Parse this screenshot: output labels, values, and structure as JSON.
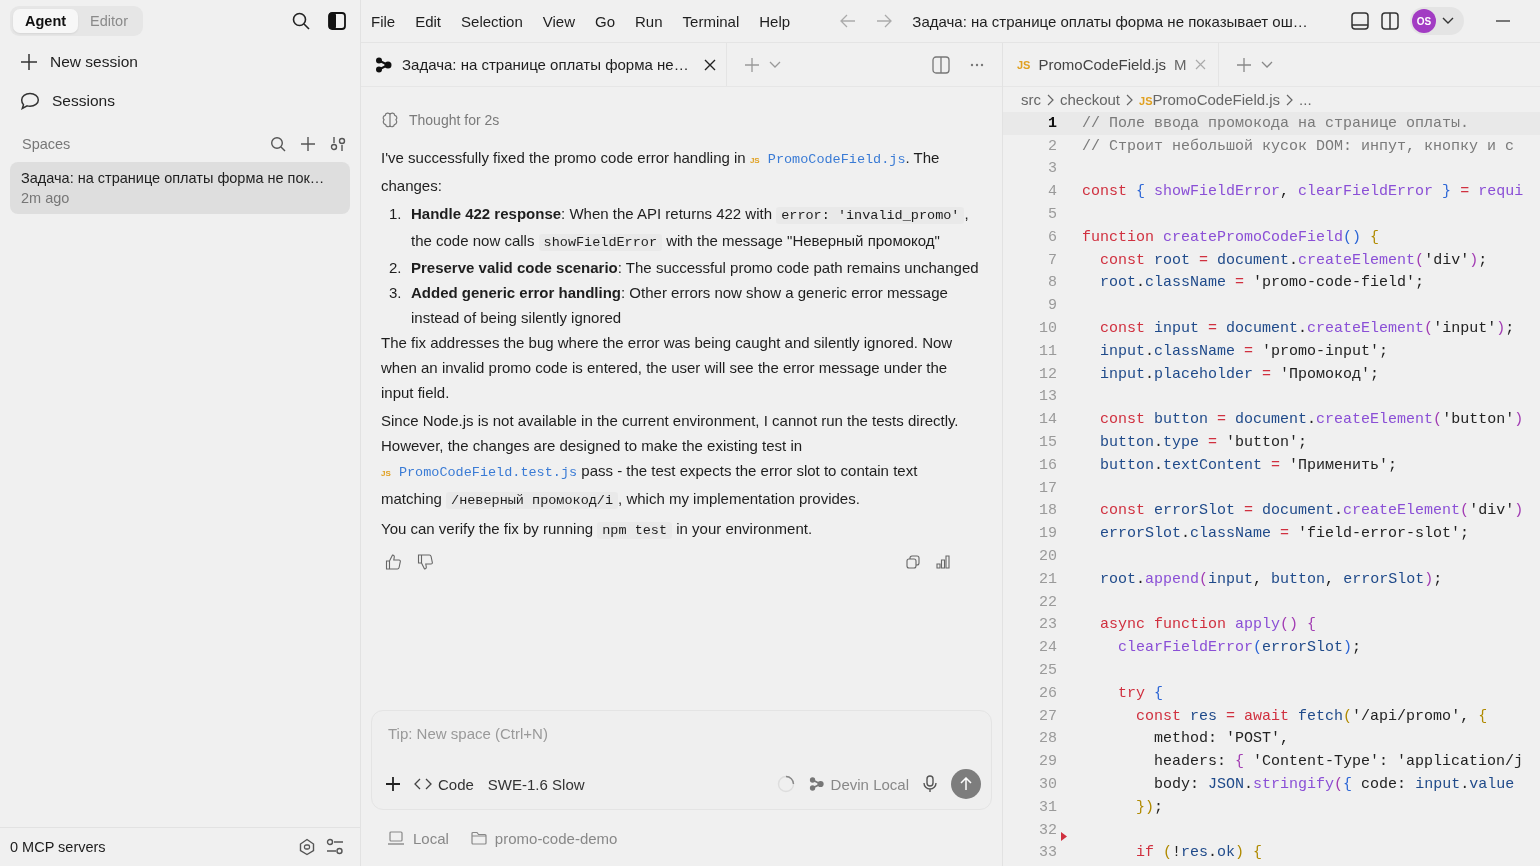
{
  "sidebar": {
    "tabs": [
      {
        "label": "Agent",
        "selected": true
      },
      {
        "label": "Editor",
        "selected": false
      }
    ],
    "actions": [
      {
        "kind": "new",
        "label": "New session"
      },
      {
        "kind": "sessions",
        "label": "Sessions"
      }
    ],
    "spaces_heading": "Spaces",
    "spaces": [
      {
        "title": "Задача: на странице оплаты форма не пок…",
        "time": "2m ago",
        "selected": true
      }
    ],
    "footer": "0 MCP servers"
  },
  "menu": [
    "File",
    "Edit",
    "Selection",
    "View",
    "Go",
    "Run",
    "Terminal",
    "Help"
  ],
  "window": {
    "title": "Задача: на странице оплаты форма не показывает ош…",
    "avatar": "OS"
  },
  "chat": {
    "tab": {
      "label": "Задача: на странице оплаты форма не…"
    },
    "thought": "Thought for 2s",
    "blocks": [
      {
        "kind": "paragraph",
        "parts": [
          {
            "kind": "text",
            "text": "I've successfully fixed the promo code error handling in "
          },
          {
            "kind": "file",
            "badge": "JS",
            "text": "PromoCodeField.js"
          },
          {
            "kind": "text",
            "text": ". The changes:"
          }
        ]
      },
      {
        "kind": "item",
        "number": "1.",
        "parts": [
          {
            "kind": "bold",
            "text": "Handle 422 response"
          },
          {
            "kind": "text",
            "text": ": When the API returns 422 with "
          },
          {
            "kind": "code",
            "text": "error: 'invalid_promo'"
          },
          {
            "kind": "text",
            "text": ", the code now calls "
          },
          {
            "kind": "code",
            "text": "showFieldError"
          },
          {
            "kind": "text",
            "text": " with the message \"Неверный промокод\""
          }
        ]
      },
      {
        "kind": "item",
        "number": "2.",
        "parts": [
          {
            "kind": "bold",
            "text": "Preserve valid code scenario"
          },
          {
            "kind": "text",
            "text": ": The successful promo code path remains unchanged"
          }
        ]
      },
      {
        "kind": "item",
        "number": "3.",
        "parts": [
          {
            "kind": "bold",
            "text": "Added generic error handling"
          },
          {
            "kind": "text",
            "text": ": Other errors now show a generic error message instead of being silently ignored"
          }
        ]
      },
      {
        "kind": "paragraph",
        "parts": [
          {
            "kind": "text",
            "text": "The fix addresses the bug where the error was being caught and silently ignored. Now when an invalid promo code is entered, the user will see the error message under the input field."
          }
        ]
      },
      {
        "kind": "paragraph",
        "parts": [
          {
            "kind": "text",
            "text": "Since Node.js is not available in the current environment, I cannot run the tests directly. However, the changes are designed to make the existing test in "
          },
          {
            "kind": "file",
            "badge": "JS",
            "text": "PromoCodeField.test.js"
          },
          {
            "kind": "text",
            "text": " pass - the test expects the error slot to contain text matching "
          },
          {
            "kind": "code",
            "text": "/неверный промокод/i"
          },
          {
            "kind": "text",
            "text": ", which my implementation provides."
          }
        ]
      },
      {
        "kind": "paragraph",
        "parts": [
          {
            "kind": "text",
            "text": "You can verify the fix by running "
          },
          {
            "kind": "code",
            "text": "npm test"
          },
          {
            "kind": "text",
            "text": " in your environment."
          }
        ]
      }
    ],
    "input": {
      "placeholder": "Tip: New space (Ctrl+N)"
    },
    "mode": "Code",
    "model": "SWE-1.6 Slow",
    "agent": "Devin Local",
    "footer": [
      {
        "kind": "local",
        "label": "Local"
      },
      {
        "kind": "folder",
        "label": "promo-code-demo"
      }
    ]
  },
  "editor": {
    "tab": {
      "badge": "JS",
      "label": "PromoCodeField.js",
      "status": "M"
    },
    "breadcrumb": [
      {
        "label": "src"
      },
      {
        "label": "checkout"
      },
      {
        "label": "PromoCodeField.js",
        "badge": "JS"
      },
      {
        "label": "..."
      }
    ],
    "lines": [
      {
        "number": "1",
        "current": true,
        "tokens": [
          {
            "kind": "comment",
            "text": "// Поле ввода промокода на странице оплаты."
          }
        ]
      },
      {
        "number": "2",
        "tokens": [
          {
            "kind": "comment",
            "text": "// Строит небольшой кусок DOM: инпут, кнопку и с"
          }
        ]
      },
      {
        "number": "3"
      },
      {
        "number": "4",
        "tokens": [
          {
            "kind": "keyword",
            "text": "const "
          },
          {
            "kind": "bracket3",
            "text": "{ "
          },
          {
            "kind": "function",
            "text": "showFieldError"
          },
          {
            "kind": "plain",
            "text": ", "
          },
          {
            "kind": "function",
            "text": "clearFieldError "
          },
          {
            "kind": "bracket3",
            "text": "} "
          },
          {
            "kind": "operator",
            "text": "= "
          },
          {
            "kind": "function",
            "text": "requi"
          }
        ]
      },
      {
        "number": "5"
      },
      {
        "number": "6",
        "tokens": [
          {
            "kind": "keyword",
            "text": "function "
          },
          {
            "kind": "function",
            "text": "createPromoCodeField"
          },
          {
            "kind": "bracket3",
            "text": "() "
          },
          {
            "kind": "bracket1",
            "text": "{"
          }
        ]
      },
      {
        "number": "7",
        "tokens": [
          {
            "kind": "keyword",
            "text": "  const "
          },
          {
            "kind": "variable",
            "text": "root "
          },
          {
            "kind": "operator",
            "text": "= "
          },
          {
            "kind": "variable",
            "text": "document"
          },
          {
            "kind": "plain",
            "text": "."
          },
          {
            "kind": "function",
            "text": "createElement"
          },
          {
            "kind": "bracket2",
            "text": "("
          },
          {
            "kind": "string",
            "text": "'div'"
          },
          {
            "kind": "bracket2",
            "text": ")"
          },
          {
            "kind": "plain",
            "text": ";"
          }
        ]
      },
      {
        "number": "8",
        "tokens": [
          {
            "kind": "variable",
            "text": "  root"
          },
          {
            "kind": "plain",
            "text": "."
          },
          {
            "kind": "variable",
            "text": "className "
          },
          {
            "kind": "operator",
            "text": "= "
          },
          {
            "kind": "string",
            "text": "'promo-code-field'"
          },
          {
            "kind": "plain",
            "text": ";"
          }
        ]
      },
      {
        "number": "9"
      },
      {
        "number": "10",
        "tokens": [
          {
            "kind": "keyword",
            "text": "  const "
          },
          {
            "kind": "variable",
            "text": "input "
          },
          {
            "kind": "operator",
            "text": "= "
          },
          {
            "kind": "variable",
            "text": "document"
          },
          {
            "kind": "plain",
            "text": "."
          },
          {
            "kind": "function",
            "text": "createElement"
          },
          {
            "kind": "bracket2",
            "text": "("
          },
          {
            "kind": "string",
            "text": "'input'"
          },
          {
            "kind": "bracket2",
            "text": ")"
          },
          {
            "kind": "plain",
            "text": ";"
          }
        ]
      },
      {
        "number": "11",
        "tokens": [
          {
            "kind": "variable",
            "text": "  input"
          },
          {
            "kind": "plain",
            "text": "."
          },
          {
            "kind": "variable",
            "text": "className "
          },
          {
            "kind": "operator",
            "text": "= "
          },
          {
            "kind": "string",
            "text": "'promo-input'"
          },
          {
            "kind": "plain",
            "text": ";"
          }
        ]
      },
      {
        "number": "12",
        "tokens": [
          {
            "kind": "variable",
            "text": "  input"
          },
          {
            "kind": "plain",
            "text": "."
          },
          {
            "kind": "variable",
            "text": "placeholder "
          },
          {
            "kind": "operator",
            "text": "= "
          },
          {
            "kind": "string",
            "text": "'Промокод'"
          },
          {
            "kind": "plain",
            "text": ";"
          }
        ]
      },
      {
        "number": "13"
      },
      {
        "number": "14",
        "tokens": [
          {
            "kind": "keyword",
            "text": "  const "
          },
          {
            "kind": "variable",
            "text": "button "
          },
          {
            "kind": "operator",
            "text": "= "
          },
          {
            "kind": "variable",
            "text": "document"
          },
          {
            "kind": "plain",
            "text": "."
          },
          {
            "kind": "function",
            "text": "createElement"
          },
          {
            "kind": "bracket2",
            "text": "("
          },
          {
            "kind": "string",
            "text": "'button'"
          },
          {
            "kind": "bracket2",
            "text": ")"
          }
        ]
      },
      {
        "number": "15",
        "tokens": [
          {
            "kind": "variable",
            "text": "  button"
          },
          {
            "kind": "plain",
            "text": "."
          },
          {
            "kind": "variable",
            "text": "type "
          },
          {
            "kind": "operator",
            "text": "= "
          },
          {
            "kind": "string",
            "text": "'button'"
          },
          {
            "kind": "plain",
            "text": ";"
          }
        ]
      },
      {
        "number": "16",
        "tokens": [
          {
            "kind": "variable",
            "text": "  button"
          },
          {
            "kind": "plain",
            "text": "."
          },
          {
            "kind": "variable",
            "text": "textContent "
          },
          {
            "kind": "operator",
            "text": "= "
          },
          {
            "kind": "string",
            "text": "'Применить'"
          },
          {
            "kind": "plain",
            "text": ";"
          }
        ]
      },
      {
        "number": "17"
      },
      {
        "number": "18",
        "tokens": [
          {
            "kind": "keyword",
            "text": "  const "
          },
          {
            "kind": "variable",
            "text": "errorSlot "
          },
          {
            "kind": "operator",
            "text": "= "
          },
          {
            "kind": "variable",
            "text": "document"
          },
          {
            "kind": "plain",
            "text": "."
          },
          {
            "kind": "function",
            "text": "createElement"
          },
          {
            "kind": "bracket2",
            "text": "("
          },
          {
            "kind": "string",
            "text": "'div'"
          },
          {
            "kind": "bracket2",
            "text": ")"
          }
        ]
      },
      {
        "number": "19",
        "tokens": [
          {
            "kind": "variable",
            "text": "  errorSlot"
          },
          {
            "kind": "plain",
            "text": "."
          },
          {
            "kind": "variable",
            "text": "className "
          },
          {
            "kind": "operator",
            "text": "= "
          },
          {
            "kind": "string",
            "text": "'field-error-slot'"
          },
          {
            "kind": "plain",
            "text": ";"
          }
        ]
      },
      {
        "number": "20"
      },
      {
        "number": "21",
        "tokens": [
          {
            "kind": "variable",
            "text": "  root"
          },
          {
            "kind": "plain",
            "text": "."
          },
          {
            "kind": "function",
            "text": "append"
          },
          {
            "kind": "bracket2",
            "text": "("
          },
          {
            "kind": "variable",
            "text": "input"
          },
          {
            "kind": "plain",
            "text": ", "
          },
          {
            "kind": "variable",
            "text": "button"
          },
          {
            "kind": "plain",
            "text": ", "
          },
          {
            "kind": "variable",
            "text": "errorSlot"
          },
          {
            "kind": "bracket2",
            "text": ")"
          },
          {
            "kind": "plain",
            "text": ";"
          }
        ]
      },
      {
        "number": "22"
      },
      {
        "number": "23",
        "tokens": [
          {
            "kind": "keyword",
            "text": "  async function "
          },
          {
            "kind": "function",
            "text": "apply"
          },
          {
            "kind": "bracket2",
            "text": "() {"
          }
        ]
      },
      {
        "number": "24",
        "tokens": [
          {
            "kind": "function",
            "text": "    clearFieldError"
          },
          {
            "kind": "bracket3",
            "text": "("
          },
          {
            "kind": "variable",
            "text": "errorSlot"
          },
          {
            "kind": "bracket3",
            "text": ")"
          },
          {
            "kind": "plain",
            "text": ";"
          }
        ]
      },
      {
        "number": "25"
      },
      {
        "number": "26",
        "tokens": [
          {
            "kind": "keyword",
            "text": "    try "
          },
          {
            "kind": "bracket3",
            "text": "{"
          }
        ]
      },
      {
        "number": "27",
        "tokens": [
          {
            "kind": "keyword",
            "text": "      const "
          },
          {
            "kind": "variable",
            "text": "res "
          },
          {
            "kind": "operator",
            "text": "= "
          },
          {
            "kind": "keyword",
            "text": "await "
          },
          {
            "kind": "variable",
            "text": "fetch"
          },
          {
            "kind": "bracket1",
            "text": "("
          },
          {
            "kind": "string",
            "text": "'/api/promo'"
          },
          {
            "kind": "plain",
            "text": ", "
          },
          {
            "kind": "bracket1",
            "text": "{"
          }
        ]
      },
      {
        "number": "28",
        "tokens": [
          {
            "kind": "plain",
            "text": "        method: "
          },
          {
            "kind": "string",
            "text": "'POST'"
          },
          {
            "kind": "plain",
            "text": ","
          }
        ]
      },
      {
        "number": "29",
        "tokens": [
          {
            "kind": "plain",
            "text": "        headers: "
          },
          {
            "kind": "bracket2",
            "text": "{ "
          },
          {
            "kind": "string",
            "text": "'Content-Type'"
          },
          {
            "kind": "plain",
            "text": ": "
          },
          {
            "kind": "string",
            "text": "'application/j"
          }
        ]
      },
      {
        "number": "30",
        "tokens": [
          {
            "kind": "plain",
            "text": "        body: "
          },
          {
            "kind": "variable",
            "text": "JSON"
          },
          {
            "kind": "plain",
            "text": "."
          },
          {
            "kind": "function",
            "text": "stringify"
          },
          {
            "kind": "bracket2",
            "text": "("
          },
          {
            "kind": "bracket3",
            "text": "{ "
          },
          {
            "kind": "plain",
            "text": "code: "
          },
          {
            "kind": "variable",
            "text": "input"
          },
          {
            "kind": "plain",
            "text": "."
          },
          {
            "kind": "variable",
            "text": "value"
          }
        ]
      },
      {
        "number": "31",
        "tokens": [
          {
            "kind": "bracket1",
            "text": "      })"
          },
          {
            "kind": "plain",
            "text": ";"
          }
        ]
      },
      {
        "number": "32",
        "marker": true
      },
      {
        "number": "33",
        "tokens": [
          {
            "kind": "keyword",
            "text": "      if "
          },
          {
            "kind": "bracket1",
            "text": "("
          },
          {
            "kind": "plain",
            "text": "!"
          },
          {
            "kind": "variable",
            "text": "res"
          },
          {
            "kind": "plain",
            "text": "."
          },
          {
            "kind": "variable",
            "text": "ok"
          },
          {
            "kind": "bracket1",
            "text": ") {"
          }
        ]
      }
    ]
  }
}
